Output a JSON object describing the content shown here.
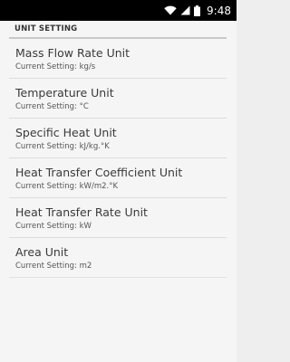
{
  "status_bar": {
    "time": "9:48",
    "icons": [
      "wifi-icon",
      "signal-icon",
      "battery-icon"
    ]
  },
  "header": {
    "title": "UNIT SETTING"
  },
  "settings": [
    {
      "title": "Mass Flow Rate Unit",
      "subtitle": "Current Setting: kg/s"
    },
    {
      "title": "Temperature Unit",
      "subtitle": "Current Setting: °C"
    },
    {
      "title": "Specific Heat Unit",
      "subtitle": "Current Setting: kJ/kg.°K"
    },
    {
      "title": "Heat Transfer Coefficient Unit",
      "subtitle": "Current Setting: kW/m2.°K"
    },
    {
      "title": "Heat Transfer Rate Unit",
      "subtitle": "Current Setting: kW"
    },
    {
      "title": "Area Unit",
      "subtitle": "Current Setting: m2"
    }
  ],
  "colors": {
    "status_bar": "#000000",
    "background": "#f5f5f5",
    "divider": "#dcdcdc",
    "text_primary": "#3a3a3a",
    "text_secondary": "#555555"
  }
}
